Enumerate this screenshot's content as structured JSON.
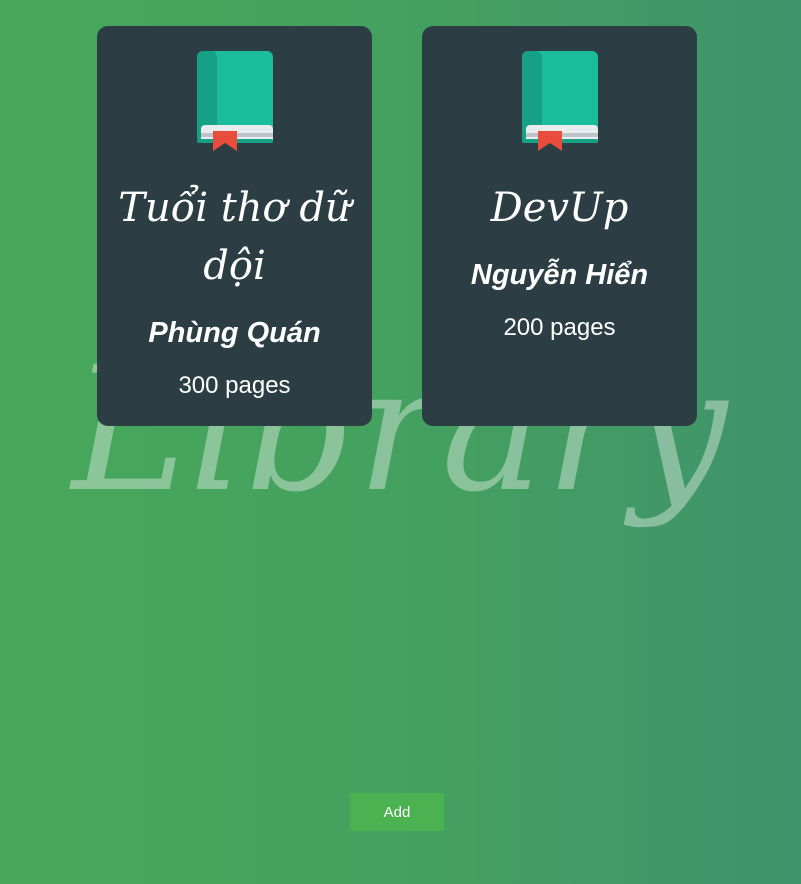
{
  "watermark": "Library",
  "books": [
    {
      "title": "Tuổi thơ dữ dội",
      "author": "Phùng Quán",
      "pages": "300 pages"
    },
    {
      "title": "DevUp",
      "author": "Nguyễn Hiển",
      "pages": "200 pages"
    }
  ],
  "add_button_label": "Add",
  "colors": {
    "card_background": "#2c3e44",
    "book_cover": "#1abc9c",
    "book_spine": "#16a085",
    "bookmark": "#e74c3c",
    "add_button": "#4bb252"
  },
  "icons": {
    "book": "book-icon"
  }
}
